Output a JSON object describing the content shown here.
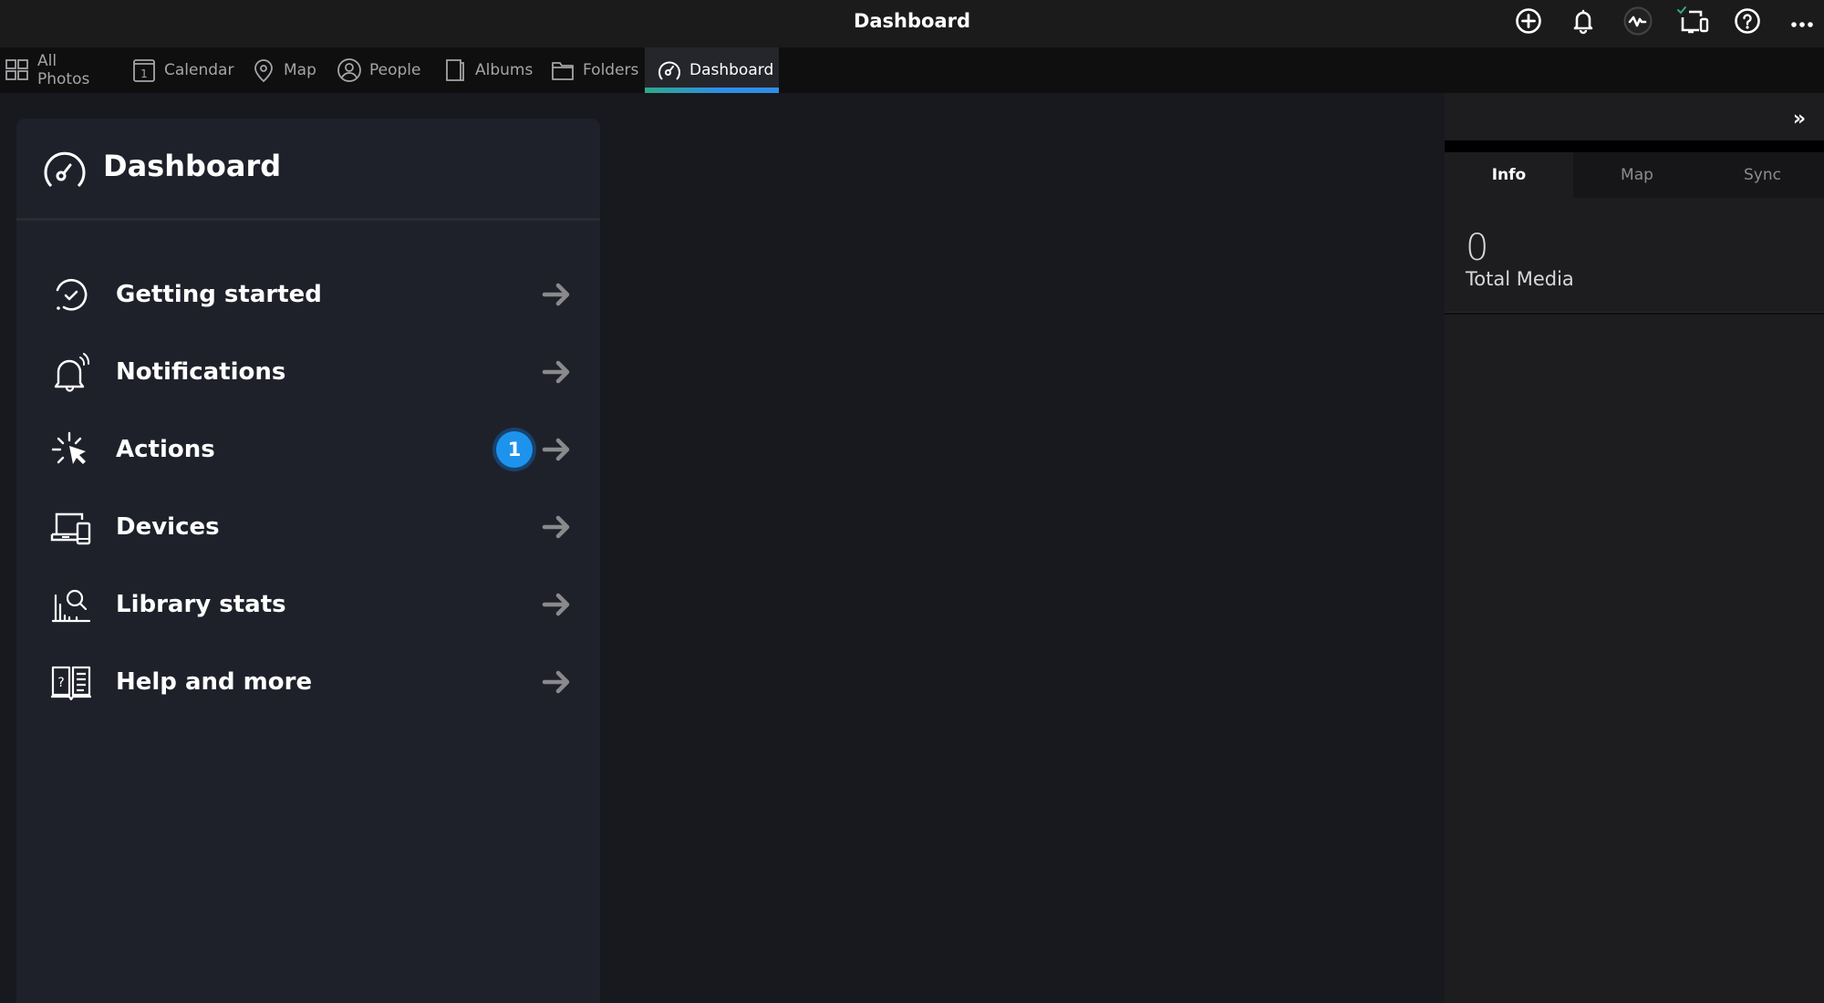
{
  "window": {
    "title": "Dashboard"
  },
  "top_icons": [
    {
      "name": "add-icon",
      "label": "Add"
    },
    {
      "name": "bell-icon",
      "label": "Notifications"
    },
    {
      "name": "activity-icon",
      "label": "Activity"
    },
    {
      "name": "devices-sync-icon",
      "label": "Devices"
    },
    {
      "name": "help-icon",
      "label": "Help"
    },
    {
      "name": "more-icon",
      "label": "More"
    }
  ],
  "nav_tabs": [
    {
      "label": "All Photos",
      "icon": "grid-icon",
      "active": false
    },
    {
      "label": "Calendar",
      "icon": "calendar-icon",
      "active": false
    },
    {
      "label": "Map",
      "icon": "map-pin-icon",
      "active": false
    },
    {
      "label": "People",
      "icon": "person-icon",
      "active": false
    },
    {
      "label": "Albums",
      "icon": "album-icon",
      "active": false
    },
    {
      "label": "Folders",
      "icon": "folder-icon",
      "active": false
    },
    {
      "label": "Dashboard",
      "icon": "gauge-icon",
      "active": true
    }
  ],
  "dashboard": {
    "title": "Dashboard",
    "items": [
      {
        "label": "Getting started",
        "icon": "checklist-circle-icon"
      },
      {
        "label": "Notifications",
        "icon": "ringing-bell-icon"
      },
      {
        "label": "Actions",
        "icon": "click-cursor-icon",
        "badge": "1"
      },
      {
        "label": "Devices",
        "icon": "laptop-phone-icon"
      },
      {
        "label": "Library stats",
        "icon": "chart-search-icon"
      },
      {
        "label": "Help and more",
        "icon": "book-help-icon"
      }
    ]
  },
  "right_panel": {
    "collapse_label": "»",
    "tabs": [
      {
        "label": "Info",
        "active": true
      },
      {
        "label": "Map",
        "active": false
      },
      {
        "label": "Sync",
        "active": false
      }
    ],
    "stat": {
      "value": "0",
      "label": "Total Media"
    }
  },
  "colors": {
    "accent_blue": "#1e93ee",
    "tab_underline_start": "#2fa88a",
    "tab_underline_end": "#2f8ee6",
    "sync_check": "#3aa37a"
  }
}
